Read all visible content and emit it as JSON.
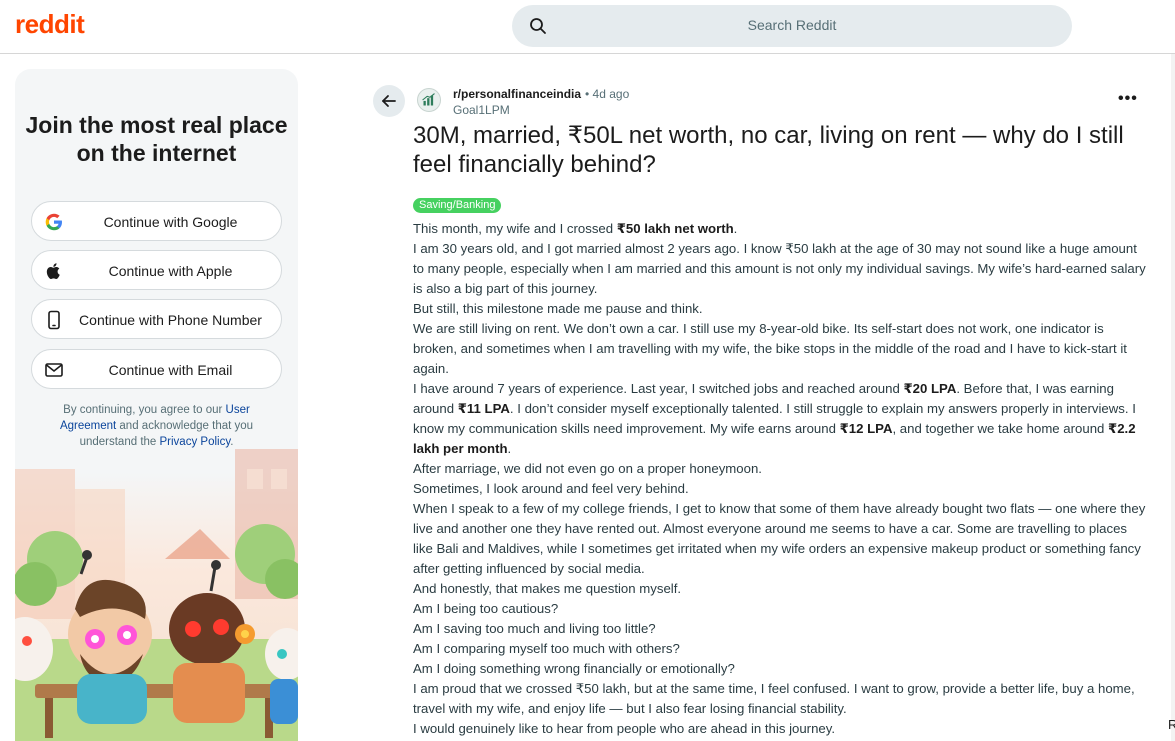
{
  "header": {
    "logo": "reddit",
    "search_placeholder": "Search Reddit",
    "search_icon": "search-icon"
  },
  "sidebar": {
    "title": "Join the most real place on the internet",
    "buttons": [
      {
        "label": "Continue with Google",
        "icon": "google-icon"
      },
      {
        "label": "Continue with Apple",
        "icon": "apple-icon"
      },
      {
        "label": "Continue with Phone Number",
        "icon": "phone-icon"
      },
      {
        "label": "Continue with Email",
        "icon": "mail-icon"
      }
    ],
    "legal": {
      "prefix": "By continuing, you agree to our ",
      "user_agreement": "User Agreement",
      "middle": " and acknowledge that you understand the ",
      "privacy_policy": "Privacy Policy",
      "suffix": "."
    }
  },
  "post": {
    "subreddit": "r/personalfinanceindia",
    "age": "• 4d ago",
    "author": "Goal1LPM",
    "title": "30M, married, ₹50L net worth, no car, living on rent — why do I still feel financially behind?",
    "flair": "Saving/Banking",
    "flair_color": "#46d160",
    "paragraphs": [
      [
        "This month, my wife and I crossed ",
        {
          "b": "₹50 lakh net worth"
        },
        "."
      ],
      [
        "I am 30 years old, and I got married almost 2 years ago. I know ₹50 lakh at the age of 30 may not sound like a huge amount to many people, especially when I am married and this amount is not only my individual savings. My wife’s hard-earned salary is also a big part of this journey."
      ],
      [
        "But still, this milestone made me pause and think."
      ],
      [
        "We are still living on rent. We don’t own a car. I still use my 8-year-old bike. Its self-start does not work, one indicator is broken, and sometimes when I am travelling with my wife, the bike stops in the middle of the road and I have to kick-start it again."
      ],
      [
        "I have around 7 years of experience. Last year, I switched jobs and reached around ",
        {
          "b": "₹20 LPA"
        },
        ". Before that, I was earning around ",
        {
          "b": "₹11 LPA"
        },
        ". I don’t consider myself exceptionally talented. I still struggle to explain my answers properly in interviews. I know my communication skills need improvement. My wife earns around ",
        {
          "b": "₹12 LPA"
        },
        ", and together we take home around ",
        {
          "b": "₹2.2 lakh per month"
        },
        "."
      ],
      [
        "After marriage, we did not even go on a proper honeymoon."
      ],
      [
        "Sometimes, I look around and feel very behind."
      ],
      [
        "When I speak to a few of my college friends, I get to know that some of them have already bought two flats — one where they live and another one they have rented out. Almost everyone around me seems to have a car. Some are travelling to places like Bali and Maldives, while I sometimes get irritated when my wife orders an expensive makeup product or something fancy after getting influenced by social media."
      ],
      [
        "And honestly, that makes me question myself."
      ],
      [
        "Am I being too cautious?"
      ],
      [
        "Am I saving too much and living too little?"
      ],
      [
        "Am I comparing myself too much with others?"
      ],
      [
        "Am I doing something wrong financially or emotionally?"
      ],
      [
        "I am proud that we crossed ₹50 lakh, but at the same time, I feel confused. I want to grow, provide a better life, buy a home, travel with my wife, and enjoy life — but I also fear losing financial stability."
      ],
      [
        "I would genuinely like to hear from people who are ahead in this journey."
      ]
    ]
  },
  "edge_text": "R"
}
